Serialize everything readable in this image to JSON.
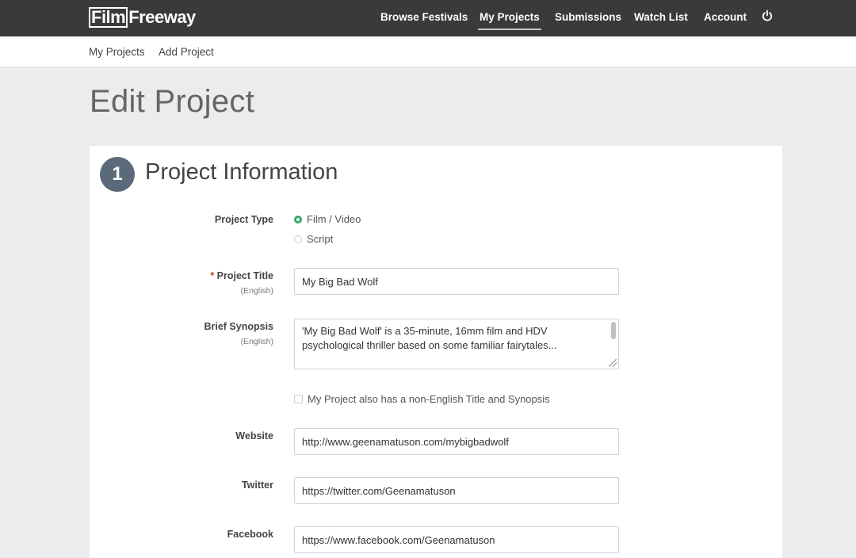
{
  "header": {
    "logo_film": "Film",
    "logo_freeway": "Freeway",
    "nav": [
      {
        "label": "Browse Festivals"
      },
      {
        "label": "My Projects"
      },
      {
        "label": "Submissions"
      },
      {
        "label": "Watch List"
      },
      {
        "label": "Account"
      }
    ],
    "power_icon": "power-icon"
  },
  "subnav": {
    "items": [
      {
        "label": "My Projects"
      },
      {
        "label": "Add Project"
      }
    ]
  },
  "page": {
    "title": "Edit Project"
  },
  "section": {
    "number": "1",
    "title": "Project Information"
  },
  "form": {
    "project_type": {
      "label": "Project Type",
      "options": [
        "Film / Video",
        "Script"
      ],
      "selected": "Film / Video"
    },
    "project_title": {
      "required_mark": "*",
      "label": "Project Title",
      "sublabel": "(English)",
      "value": "My Big Bad Wolf"
    },
    "synopsis": {
      "label": "Brief Synopsis",
      "sublabel": "(English)",
      "line1": "'My Big Bad Wolf' is a 35-minute, 16mm film and HDV",
      "line2": "psychological thriller based on some familiar fairytales..."
    },
    "non_english": {
      "label": "My Project also has a non-English Title and Synopsis",
      "checked": false
    },
    "website": {
      "label": "Website",
      "value": "http://www.geenamatuson.com/mybigbadwolf"
    },
    "twitter": {
      "label": "Twitter",
      "value": "https://twitter.com/Geenamatuson"
    },
    "facebook": {
      "label": "Facebook",
      "value": "https://www.facebook.com/Geenamatuson"
    }
  },
  "colors": {
    "topbar": "#3a3a3a",
    "accent_green": "#3aa36c",
    "step_circle": "#5b6a7a",
    "page_bg": "#ececec"
  }
}
